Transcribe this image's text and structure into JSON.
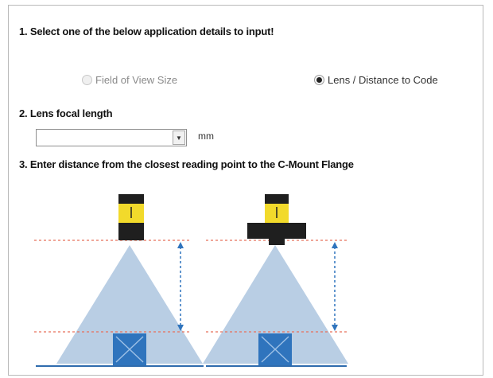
{
  "step1": {
    "heading": "1. Select one of the below application details to input!",
    "options": [
      {
        "label": "Field of View Size",
        "selected": false,
        "enabled": false
      },
      {
        "label": "Lens / Distance to Code",
        "selected": true,
        "enabled": true
      }
    ]
  },
  "step2": {
    "heading": "2. Lens focal length",
    "value": "",
    "unit": "mm",
    "dropdown_icon": "chevron-down-icon"
  },
  "step3": {
    "heading": "3. Enter distance from the closest reading point to the C-Mount Flange"
  },
  "colors": {
    "camera_body": "#1f1f1f",
    "camera_band": "#f2da2b",
    "cone": "#b9cee4",
    "target": "#2f74bd",
    "guide_line": "#e8705a",
    "dimension_arrow": "#2f74bd",
    "ground": "#2f6cae"
  }
}
